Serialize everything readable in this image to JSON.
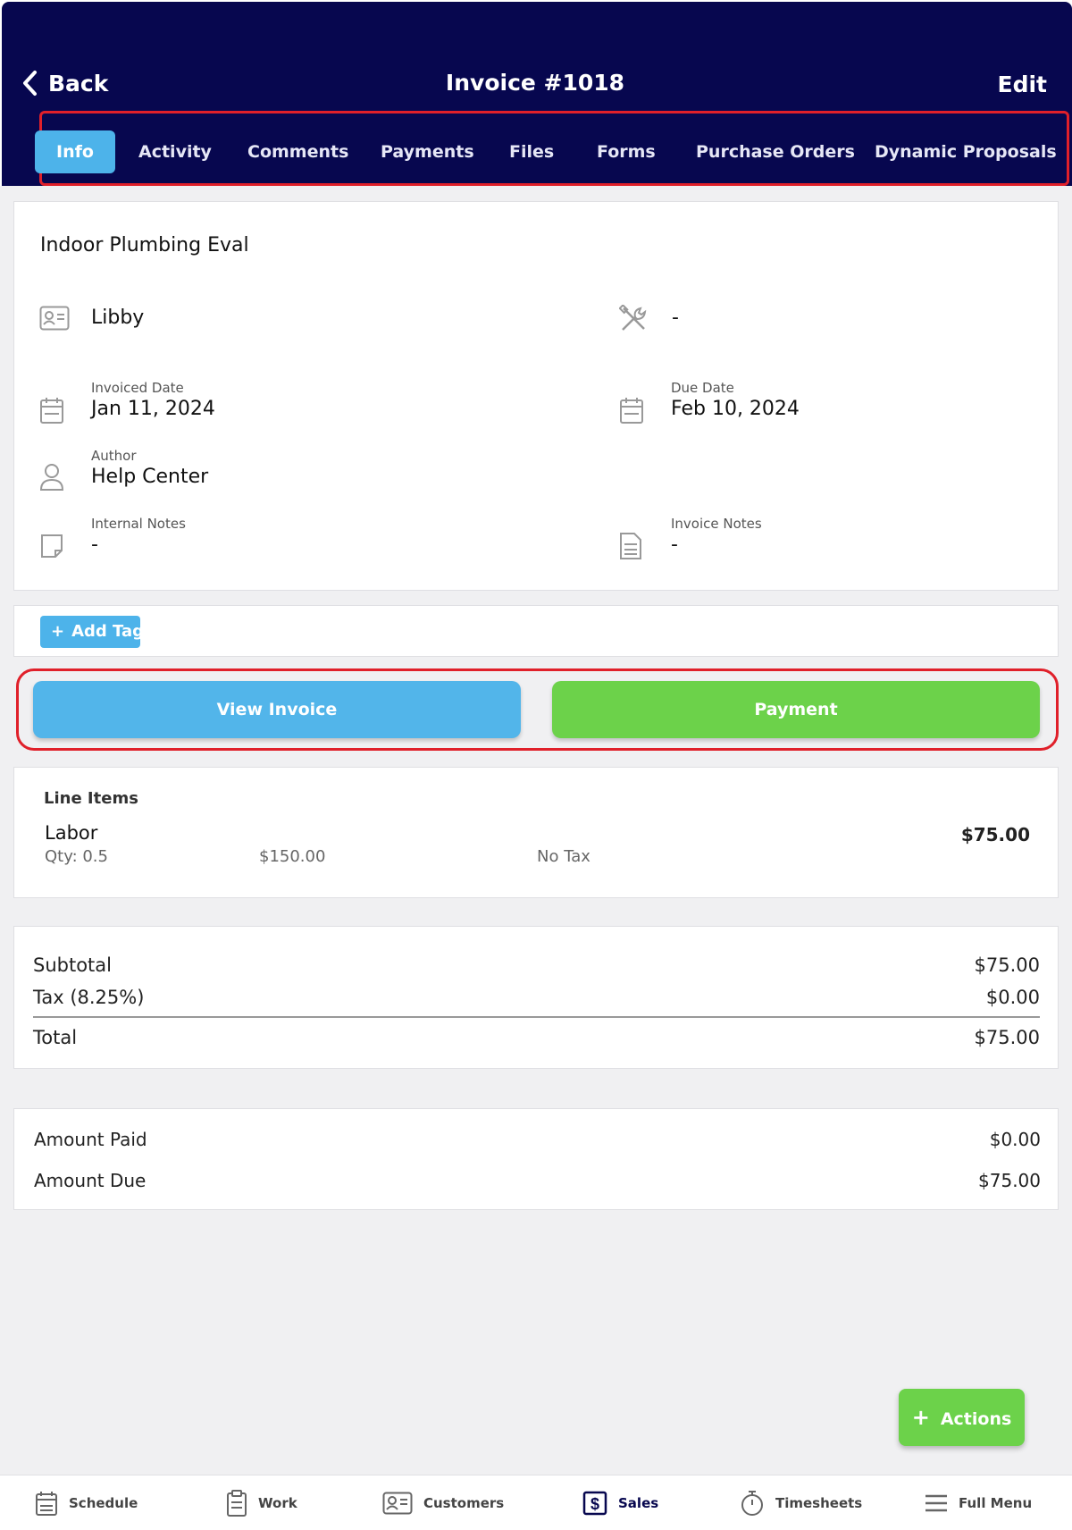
{
  "header": {
    "back_label": "Back",
    "title": "Invoice #1018",
    "edit_label": "Edit",
    "bg_color": "#07074f"
  },
  "tabs": [
    {
      "label": "Info",
      "active": true
    },
    {
      "label": "Activity"
    },
    {
      "label": "Comments"
    },
    {
      "label": "Payments"
    },
    {
      "label": "Files"
    },
    {
      "label": "Forms"
    },
    {
      "label": "Purchase Orders"
    },
    {
      "label": "Dynamic Proposals"
    }
  ],
  "info": {
    "job_name": "Indoor Plumbing Eval",
    "customer": "Libby",
    "technician": "-",
    "invoiced_date_label": "Invoiced Date",
    "invoiced_date": "Jan 11, 2024",
    "due_date_label": "Due Date",
    "due_date": "Feb 10, 2024",
    "author_label": "Author",
    "author": "Help Center",
    "internal_notes_label": "Internal Notes",
    "internal_notes": "-",
    "invoice_notes_label": "Invoice Notes",
    "invoice_notes": "-"
  },
  "tag": {
    "label": "Add Tag",
    "plus": "+"
  },
  "actions": {
    "view_invoice": "View Invoice",
    "payment": "Payment"
  },
  "line_items": {
    "heading": "Line Items",
    "items": [
      {
        "name": "Labor",
        "qty": "Qty: 0.5",
        "rate": "$150.00",
        "tax": "No Tax",
        "amount": "$75.00"
      }
    ]
  },
  "totals": {
    "subtotal_label": "Subtotal",
    "subtotal": "$75.00",
    "tax_label": "Tax (8.25%)",
    "tax": "$0.00",
    "total_label": "Total",
    "total": "$75.00"
  },
  "payments": {
    "paid_label": "Amount Paid",
    "paid": "$0.00",
    "due_label": "Amount Due",
    "due": "$75.00"
  },
  "fab": {
    "plus": "+",
    "label": "Actions"
  },
  "bottom_nav": [
    {
      "label": "Schedule",
      "icon": "calendar-icon"
    },
    {
      "label": "Work",
      "icon": "clipboard-icon"
    },
    {
      "label": "Customers",
      "icon": "contact-card-icon"
    },
    {
      "label": "Sales",
      "icon": "dollar-icon",
      "active": true
    },
    {
      "label": "Timesheets",
      "icon": "stopwatch-icon"
    },
    {
      "label": "Full Menu",
      "icon": "menu-icon"
    }
  ],
  "colors": {
    "accent_blue": "#4db3ea",
    "accent_green": "#6cd24a",
    "highlight_red": "#e0202a"
  }
}
